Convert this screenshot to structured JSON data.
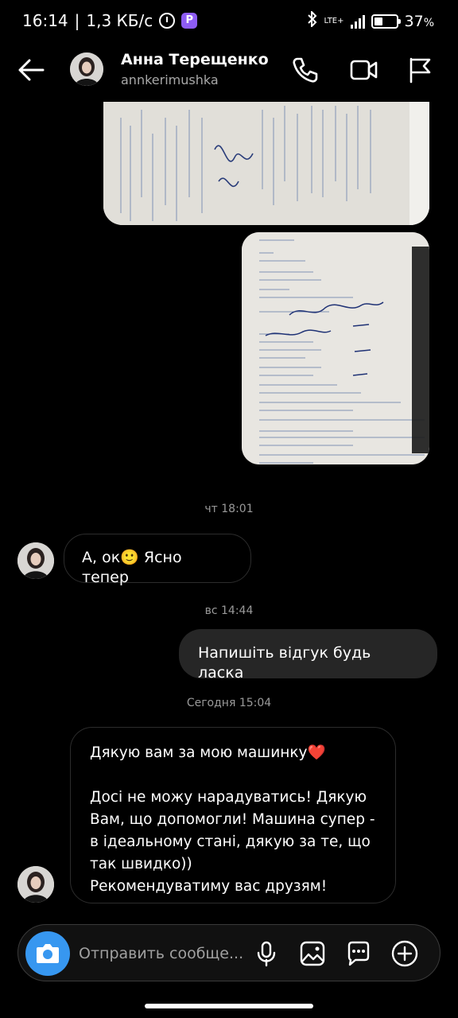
{
  "status_bar": {
    "time": "16:14",
    "separator": "|",
    "speed": "1,3 КБ/с",
    "app_badge": "P",
    "network": "LTE+",
    "battery": "37",
    "battery_unit": "%"
  },
  "header": {
    "name": "Анна Терещенко",
    "username": "annkerimushka"
  },
  "messages": {
    "ts1": "чт 18:01",
    "msg1": "А, ок🙂 Ясно тепер",
    "ts2": "вс 14:44",
    "msg2": "Напишіть відгук будь ласка",
    "ts3": "Сегодня 15:04",
    "msg3": "Дякую вам за мою машинку❤️\n\nДосі не можу нарадуватись! Дякую Вам, що допомогли! Машина супер - в ідеальному стані, дякую за те, що так швидко))\nРекомендуватиму вас друзям!"
  },
  "composer": {
    "placeholder": "Отправить сообще..."
  },
  "icons": {
    "back": "arrow-left",
    "call": "phone",
    "video": "video-camera",
    "flag": "flag",
    "camera": "camera",
    "mic": "microphone",
    "gallery": "image",
    "sticker": "chat-bubble",
    "add": "plus-circle"
  },
  "colors": {
    "background": "#000000",
    "outgoing_bubble": "#262626",
    "camera_button": "#3797f0",
    "secondary_text": "#a8a8a8"
  }
}
